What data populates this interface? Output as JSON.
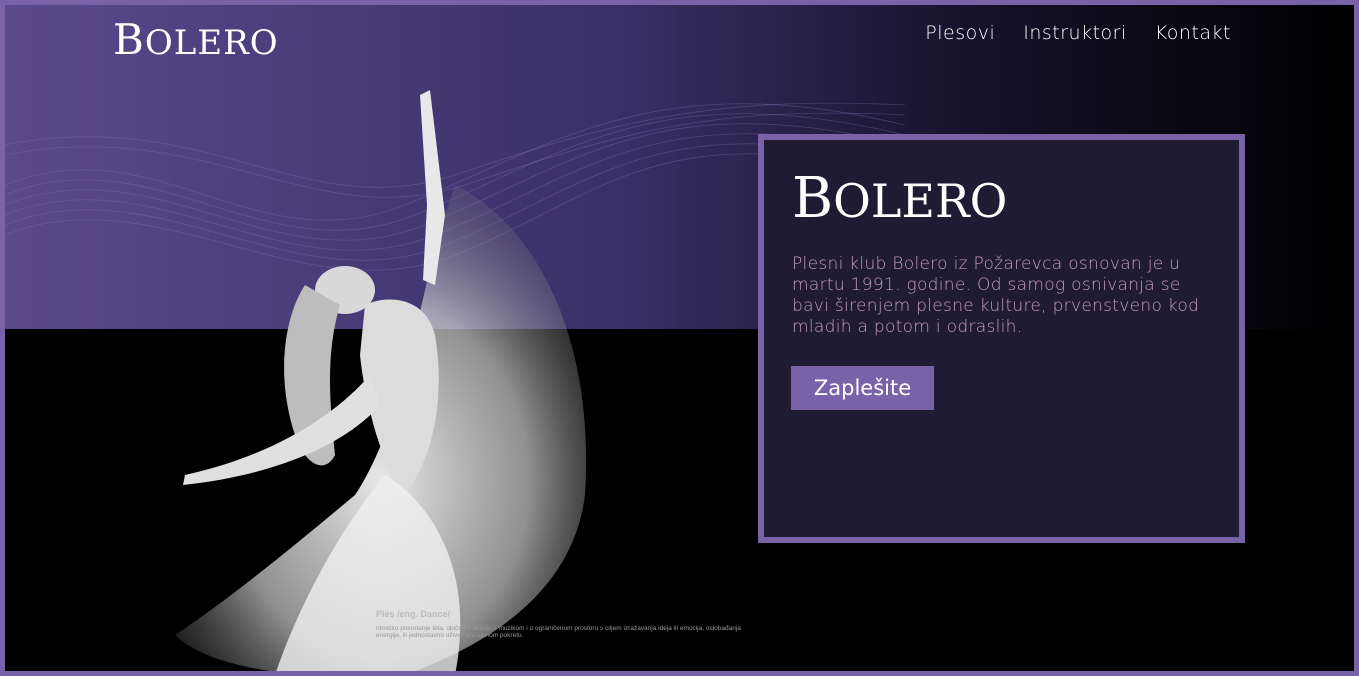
{
  "header": {
    "logo_text": "Bolero",
    "nav": [
      {
        "label": "Plesovi"
      },
      {
        "label": "Instruktori"
      },
      {
        "label": "Kontakt"
      }
    ]
  },
  "hero": {
    "caption_title": "Ples /eng. Dance/",
    "caption_text": "ritmičko pokretanje tela, obično u skladu s muzikom i u ograničenom prostoru s ciljem izražavanja ideja ili emocija, oslobađanja energije, ili jednostavno uživanja u samom pokretu."
  },
  "card": {
    "logo_text": "Bolero",
    "description": "Plesni klub Bolero iz Požarevca osnovan je u martu 1991. godine. Od samog osnivanja se bavi širenjem plesne kulture, prvenstveno kod mladih a potom i odraslih.",
    "cta_label": "Zaplešite"
  },
  "colors": {
    "accent": "#7a62a8",
    "card_bg": "#1f1b33",
    "text_pink": "#c39ac9"
  }
}
